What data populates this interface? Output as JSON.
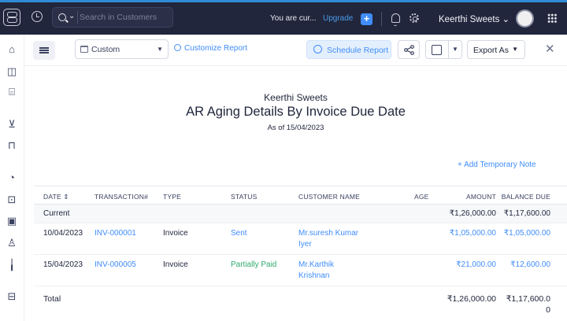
{
  "topbar": {
    "search_placeholder": "Search in Customers",
    "trial_text": "You are cur...",
    "upgrade_label": "Upgrade",
    "org_menu": "Keerthi Sweets"
  },
  "sidebar": {
    "items": [
      "home-icon",
      "items-icon",
      "banking-icon",
      "sales-icon",
      "purchases-icon",
      "time-tracking-icon",
      "accountant-icon",
      "ewaybill-icon",
      "users-icon",
      "reports-icon",
      "documents-icon"
    ]
  },
  "toolbar": {
    "date_range": "Custom",
    "customize_label": "Customize Report",
    "schedule_label": "Schedule Report",
    "export_label": "Export As"
  },
  "report": {
    "org": "Keerthi Sweets",
    "title": "AR Aging Details By Invoice Due Date",
    "as_of": "As of 15/04/2023",
    "add_note": "+ Add Temporary Note",
    "columns": {
      "date": "DATE",
      "transaction": "TRANSACTION#",
      "type": "TYPE",
      "status": "STATUS",
      "customer": "CUSTOMER NAME",
      "age": "AGE",
      "amount": "AMOUNT",
      "balance": "BALANCE DUE"
    },
    "group": {
      "label": "Current",
      "amount": "₹1,26,000.00",
      "balance": "₹1,17,600.00"
    },
    "rows": [
      {
        "date": "10/04/2023",
        "transaction": "INV-000001",
        "type": "Invoice",
        "status": "Sent",
        "customer_line1": "Mr.suresh Kumar",
        "customer_line2": "Iyer",
        "amount": "₹1,05,000.00",
        "balance": "₹1,05,000.00"
      },
      {
        "date": "15/04/2023",
        "transaction": "INV-000005",
        "type": "Invoice",
        "status": "Partially Paid",
        "customer_line1": "Mr.Karthik",
        "customer_line2": "Krishnan",
        "amount": "₹21,000.00",
        "balance": "₹12,600.00"
      }
    ],
    "total": {
      "label": "Total",
      "amount": "₹1,26,000.00",
      "balance_line1": "₹1,17,600.0",
      "balance_line2": "0"
    }
  },
  "colors": {
    "topbar_bg": "#21263c",
    "accent": "#408dfb",
    "status_green": "#2fab6d"
  }
}
